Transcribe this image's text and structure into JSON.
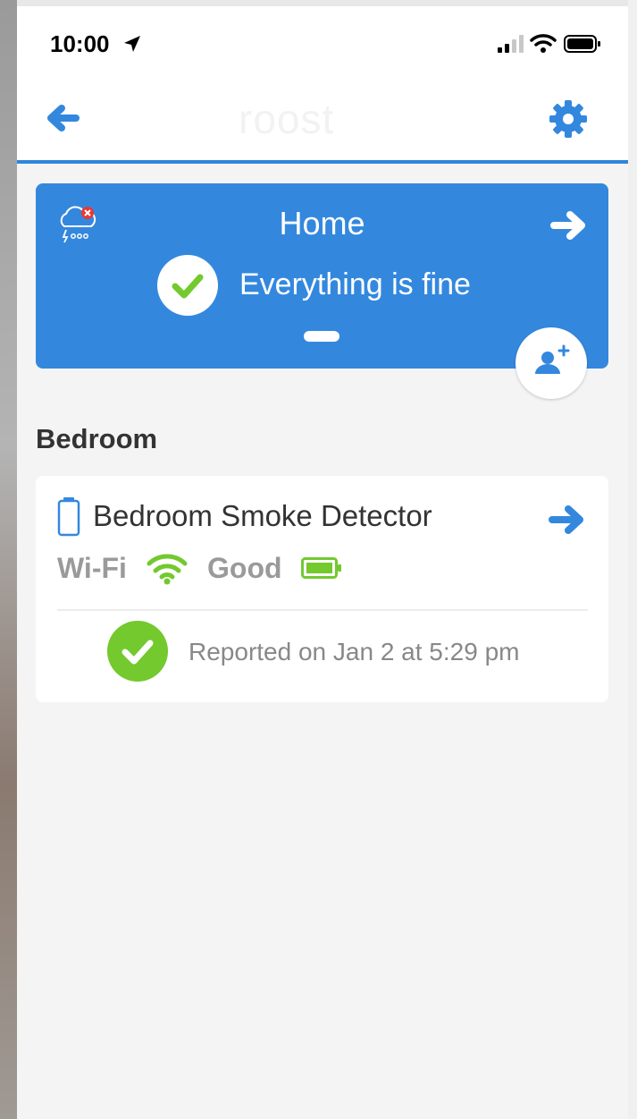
{
  "statusbar": {
    "time": "10:00"
  },
  "navbar": {
    "logo": "roost"
  },
  "home": {
    "title": "Home",
    "status": "Everything is fine"
  },
  "room": {
    "name": "Bedroom",
    "device": {
      "name": "Bedroom Smoke Detector",
      "connection_label": "Wi-Fi",
      "connection_status": "Good",
      "report": "Reported on Jan 2 at 5:29 pm"
    }
  },
  "colors": {
    "accent_blue": "#3388de",
    "ok_green": "#73c92d",
    "alert_red": "#e53935",
    "screen_bg": "#f4f4f4"
  },
  "icons": [
    "location-arrow-icon",
    "signal-icon",
    "wifi-icon",
    "battery-icon",
    "back-arrow-icon",
    "gear-icon",
    "weather-icon",
    "forward-arrow-icon",
    "check-icon",
    "add-user-icon",
    "device-icon"
  ]
}
